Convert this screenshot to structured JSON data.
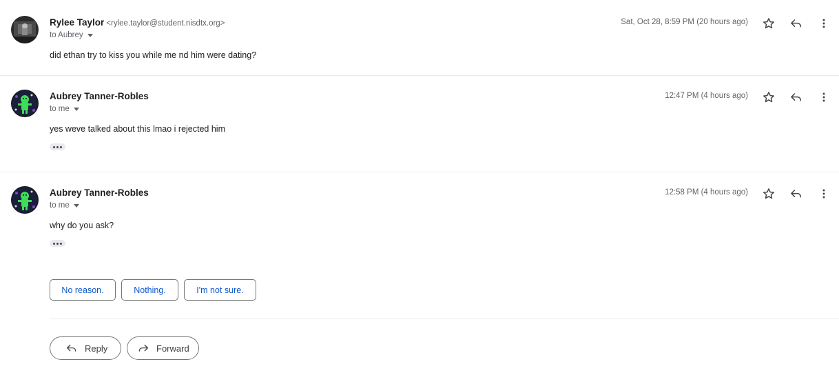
{
  "messages": [
    {
      "sender": "Rylee Taylor",
      "email": "<rylee.taylor@student.nisdtx.org>",
      "recipient": "to Aubrey",
      "time": "Sat, Oct 28, 8:59 PM (20 hours ago)",
      "body": "did ethan try to kiss you while me nd him were dating?"
    },
    {
      "sender": "Aubrey Tanner-Robles",
      "recipient": "to me",
      "time": "12:47 PM (4 hours ago)",
      "body": "yes weve talked about this lmao i rejected him"
    },
    {
      "sender": "Aubrey Tanner-Robles",
      "recipient": "to me",
      "time": "12:58 PM (4 hours ago)",
      "body": "why do you ask?"
    }
  ],
  "smart_replies": [
    "No reason.",
    "Nothing.",
    "I'm not sure."
  ],
  "actions": {
    "reply": "Reply",
    "forward": "Forward"
  },
  "icons": {
    "star": "star-icon",
    "reply": "reply-icon",
    "more": "more-vert-icon",
    "caret": "caret-down-icon",
    "forward": "forward-icon"
  },
  "colors": {
    "link_blue": "#0b57d0",
    "avatar_green": "#3fdc5a"
  }
}
